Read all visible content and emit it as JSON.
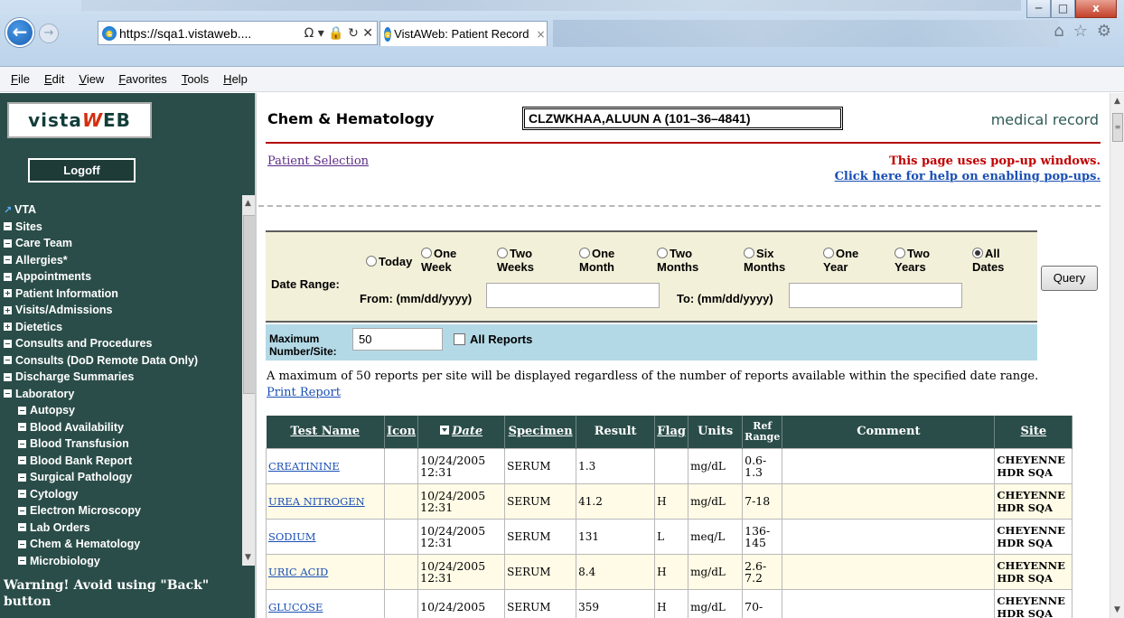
{
  "browser": {
    "url": "https://sqa1.vistaweb....",
    "addr_tools": "Ω ▾ 🔒 ↻ ✕",
    "tab_title": "VistAWeb: Patient Record",
    "tab_close": "×",
    "back": "←",
    "forward": "→",
    "home_icon": "⌂",
    "star_icon": "☆",
    "gear_icon": "⚙",
    "win_min": "─",
    "win_max": "□",
    "win_close": "x"
  },
  "menu": [
    "File",
    "Edit",
    "View",
    "Favorites",
    "Tools",
    "Help"
  ],
  "sidebar": {
    "logo_prefix": "vista",
    "logo_w": "W",
    "logo_suffix": "EB",
    "logoff": "Logoff",
    "items": [
      {
        "label": "VTA",
        "type": "link"
      },
      {
        "label": "Sites",
        "type": "minus"
      },
      {
        "label": "Care Team",
        "type": "minus"
      },
      {
        "label": "Allergies*",
        "type": "minus"
      },
      {
        "label": "Appointments",
        "type": "minus"
      },
      {
        "label": "Patient Information",
        "type": "plus"
      },
      {
        "label": "Visits/Admissions",
        "type": "plus"
      },
      {
        "label": "Dietetics",
        "type": "plus"
      },
      {
        "label": "Consults and Procedures",
        "type": "minus"
      },
      {
        "label": "Consults (DoD Remote Data Only)",
        "type": "minus"
      },
      {
        "label": "Discharge Summaries",
        "type": "minus"
      },
      {
        "label": "Laboratory",
        "type": "minus"
      }
    ],
    "lab_items": [
      "Autopsy",
      "Blood Availability",
      "Blood Transfusion",
      "Blood Bank Report",
      "Surgical Pathology",
      "Cytology",
      "Electron Microscopy",
      "Lab Orders",
      "Chem & Hematology",
      "Microbiology"
    ],
    "warning": "Warning! Avoid using \"Back\" button"
  },
  "header": {
    "title": "Chem & Hematology",
    "patient": "CLZWKHAA,ALUUN A (101–36–4841)",
    "medical_record": "medical record"
  },
  "links": {
    "patient_selection": "Patient Selection",
    "popup_warning": "This page uses pop-up windows.",
    "popup_help": "Click here for help on enabling pop-ups.",
    "print_report": "Print Report"
  },
  "date_range": {
    "label": "Date Range:",
    "options": [
      {
        "line1": "Today",
        "line2": "",
        "selected": false
      },
      {
        "line1": "One",
        "line2": "Week",
        "selected": false
      },
      {
        "line1": "Two",
        "line2": "Weeks",
        "selected": false
      },
      {
        "line1": "One",
        "line2": "Month",
        "selected": false
      },
      {
        "line1": "Two",
        "line2": "Months",
        "selected": false
      },
      {
        "line1": "Six",
        "line2": "Months",
        "selected": false
      },
      {
        "line1": "One",
        "line2": "Year",
        "selected": false
      },
      {
        "line1": "Two",
        "line2": "Years",
        "selected": false
      },
      {
        "line1": "All",
        "line2": "Dates",
        "selected": true
      }
    ],
    "from_label": "From: (mm/dd/yyyy)",
    "from_value": "",
    "to_label": "To: (mm/dd/yyyy)",
    "to_value": "",
    "query": "Query"
  },
  "max_reports": {
    "label_line1": "Maximum",
    "label_line2": "Number/Site:",
    "value": "50",
    "all_reports": "All Reports",
    "all_reports_checked": false,
    "note": "A maximum of 50 reports per site will be displayed regardless of the number of reports available within the specified date range."
  },
  "table": {
    "headers": [
      "Test Name",
      "Icon",
      "Date",
      "Specimen",
      "Result",
      "Flag",
      "Units",
      "Ref Range",
      "Comment",
      "Site"
    ],
    "rows": [
      {
        "test": "CREATININE",
        "icon": "",
        "date1": "10/24/2005",
        "date2": "12:31",
        "specimen": "SERUM",
        "result": "1.3",
        "flag": "",
        "units": "mg/dL",
        "ref1": "0.6-",
        "ref2": "1.3",
        "comment": "",
        "site1": "CHEYENNE",
        "site2": "HDR SQA"
      },
      {
        "test": "UREA NITROGEN",
        "icon": "",
        "date1": "10/24/2005",
        "date2": "12:31",
        "specimen": "SERUM",
        "result": "41.2",
        "flag": "H",
        "units": "mg/dL",
        "ref1": "7-18",
        "ref2": "",
        "comment": "",
        "site1": "CHEYENNE",
        "site2": "HDR SQA"
      },
      {
        "test": "SODIUM",
        "icon": "",
        "date1": "10/24/2005",
        "date2": "12:31",
        "specimen": "SERUM",
        "result": "131",
        "flag": "L",
        "units": "meq/L",
        "ref1": "136-",
        "ref2": "145",
        "comment": "",
        "site1": "CHEYENNE",
        "site2": "HDR SQA"
      },
      {
        "test": "URIC ACID",
        "icon": "",
        "date1": "10/24/2005",
        "date2": "12:31",
        "specimen": "SERUM",
        "result": "8.4",
        "flag": "H",
        "units": "mg/dL",
        "ref1": "2.6-",
        "ref2": "7.2",
        "comment": "",
        "site1": "CHEYENNE",
        "site2": "HDR SQA"
      },
      {
        "test": "GLUCOSE",
        "icon": "",
        "date1": "10/24/2005",
        "date2": "",
        "specimen": "SERUM",
        "result": "359",
        "flag": "H",
        "units": "mg/dL",
        "ref1": "70-",
        "ref2": "",
        "comment": "",
        "site1": "CHEYENNE",
        "site2": "HDR SQA"
      }
    ]
  },
  "colors": {
    "sidebar_bg": "#2a4d49",
    "header_rule": "#b30000",
    "date_panel_bg": "#f3f0d9",
    "max_panel_bg": "#b3d9e6"
  }
}
